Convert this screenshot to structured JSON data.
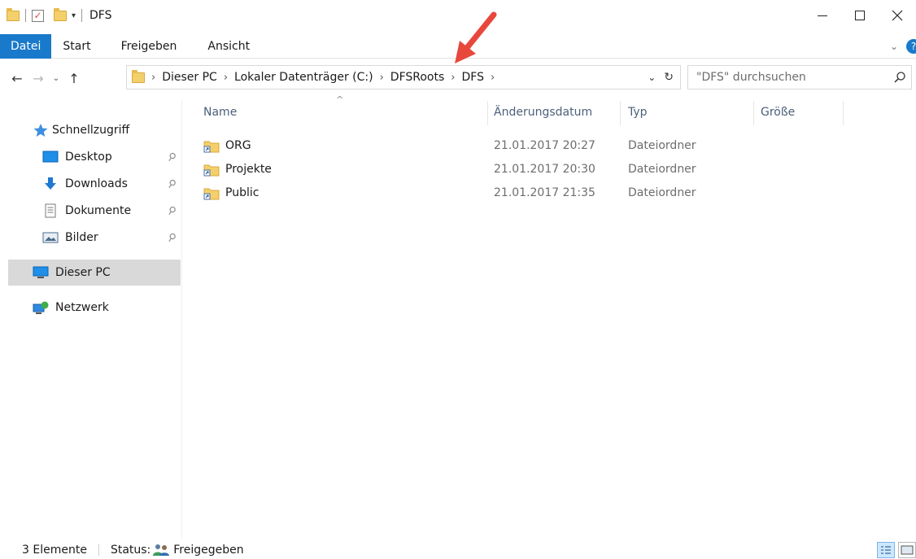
{
  "window": {
    "title": "DFS"
  },
  "ribbon": {
    "tabs": [
      "Datei",
      "Start",
      "Freigeben",
      "Ansicht"
    ],
    "help_label": "?"
  },
  "navigation": {
    "back_icon": "←",
    "forward_icon": "→",
    "recent_icon": "⌄",
    "up_icon": "↑"
  },
  "address": {
    "crumbs": [
      "Dieser PC",
      "Lokaler Datenträger (C:)",
      "DFSRoots",
      "DFS"
    ],
    "separator": "›",
    "dropdown_icon": "⌄",
    "refresh_icon": "↻"
  },
  "search": {
    "placeholder": "\"DFS\" durchsuchen"
  },
  "sidebar": {
    "quick_access": "Schnellzugriff",
    "pinned": [
      {
        "label": "Desktop",
        "icon": "desktop-icon"
      },
      {
        "label": "Downloads",
        "icon": "downloads-icon"
      },
      {
        "label": "Dokumente",
        "icon": "documents-icon"
      },
      {
        "label": "Bilder",
        "icon": "pictures-icon"
      }
    ],
    "this_pc": "Dieser PC",
    "network": "Netzwerk",
    "pin_glyph": "📌"
  },
  "columns": {
    "name": "Name",
    "date": "Änderungsdatum",
    "type": "Typ",
    "size": "Größe",
    "sort_glyph": "^"
  },
  "files": [
    {
      "name": "ORG",
      "date": "21.01.2017 20:27",
      "type": "Dateiordner"
    },
    {
      "name": "Projekte",
      "date": "21.01.2017 20:30",
      "type": "Dateiordner"
    },
    {
      "name": "Public",
      "date": "21.01.2017 21:35",
      "type": "Dateiordner"
    }
  ],
  "status": {
    "count": "3 Elemente",
    "label": "Status:",
    "value": "Freigegeben"
  },
  "colors": {
    "accent": "#1979ca",
    "folder": "#f3d06b",
    "annotation_arrow": "#e8473c",
    "selected_bg": "#d9d9d9"
  }
}
